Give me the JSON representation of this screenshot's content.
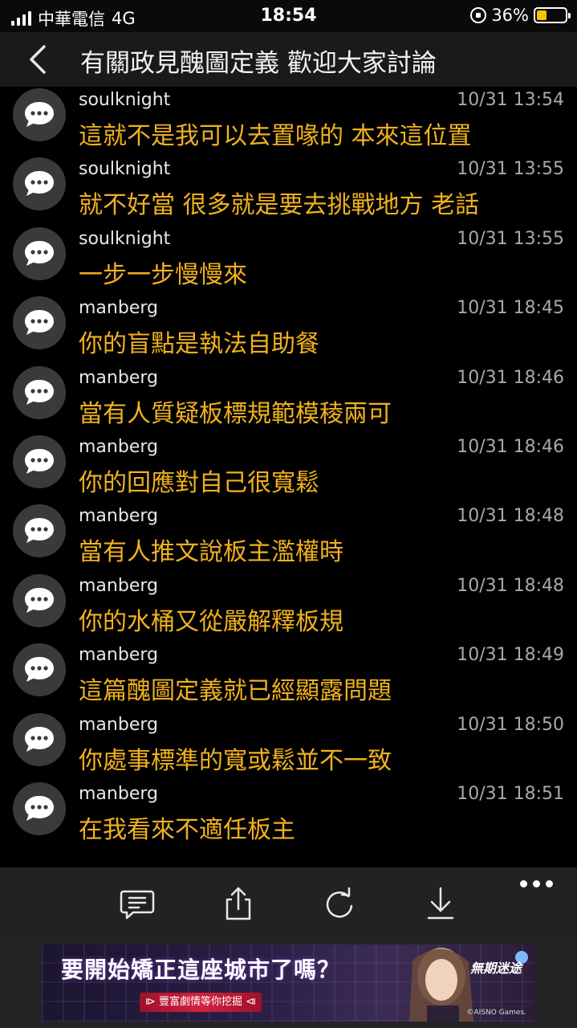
{
  "status_bar": {
    "carrier": "中華電信",
    "network": "4G",
    "time": "18:54",
    "battery_percent": "36%",
    "battery_level": 0.36
  },
  "header": {
    "title": "有關政見醜圖定義  歡迎大家討論"
  },
  "messages": [
    {
      "author": "soulknight",
      "time": "10/31 13:54",
      "text": "這就不是我可以去置喙的 本來這位置"
    },
    {
      "author": "soulknight",
      "time": "10/31 13:55",
      "text": "就不好當 很多就是要去挑戰地方 老話"
    },
    {
      "author": "soulknight",
      "time": "10/31 13:55",
      "text": "一步一步慢慢來"
    },
    {
      "author": "manberg",
      "time": "10/31 18:45",
      "text": "你的盲點是執法自助餐"
    },
    {
      "author": "manberg",
      "time": "10/31 18:46",
      "text": "當有人質疑板標規範模稜兩可"
    },
    {
      "author": "manberg",
      "time": "10/31 18:46",
      "text": "你的回應對自己很寬鬆"
    },
    {
      "author": "manberg",
      "time": "10/31 18:48",
      "text": "當有人推文說板主濫權時"
    },
    {
      "author": "manberg",
      "time": "10/31 18:48",
      "text": "你的水桶又從嚴解釋板規"
    },
    {
      "author": "manberg",
      "time": "10/31 18:49",
      "text": "這篇醜圖定義就已經顯露問題"
    },
    {
      "author": "manberg",
      "time": "10/31 18:50",
      "text": "你處事標準的寬或鬆並不一致"
    },
    {
      "author": "manberg",
      "time": "10/31 18:51",
      "text": "在我看來不適任板主"
    }
  ],
  "toolbar": {
    "icons": [
      "comment-icon",
      "share-icon",
      "refresh-icon",
      "download-icon",
      "more-icon"
    ]
  },
  "ad": {
    "headline": "要開始矯正這座城市了嗎？",
    "button": "⧐ 豐富劇情等你挖掘 ⧏",
    "logo": "無期迷途",
    "copyright": "©AISNO Games."
  },
  "colors": {
    "background": "#000000",
    "header_bg": "#1a1a1a",
    "message_text": "#f0b11e",
    "author_text": "#e8e8e8",
    "timestamp_text": "#a9a9a9",
    "toolbar_bg": "#222224",
    "battery_fill": "#f5c400"
  }
}
